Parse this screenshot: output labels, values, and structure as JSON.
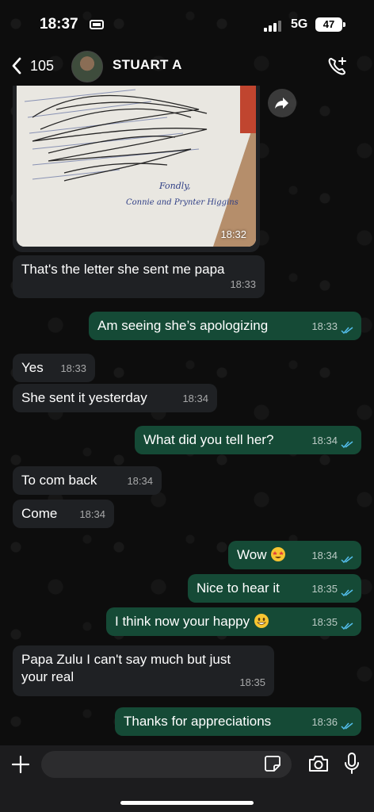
{
  "status_bar": {
    "time": "18:37",
    "network": "5G",
    "battery": "47"
  },
  "header": {
    "back_count": "105",
    "contact_name": "STUART A"
  },
  "messages": [
    {
      "dir": "in",
      "type": "image",
      "time": "18:32"
    },
    {
      "dir": "in",
      "text": "That's the letter she sent me papa",
      "time": "18:33"
    },
    {
      "dir": "out",
      "text": "Am seeing she’s apologizing",
      "time": "18:33",
      "status": "read"
    },
    {
      "dir": "in",
      "text": "Yes",
      "time": "18:33"
    },
    {
      "dir": "in",
      "text": "She sent it yesterday",
      "time": "18:34"
    },
    {
      "dir": "out",
      "text": "What did you tell her?",
      "time": "18:34",
      "status": "read"
    },
    {
      "dir": "in",
      "text": "To com back",
      "time": "18:34"
    },
    {
      "dir": "in",
      "text": "Come",
      "time": "18:34"
    },
    {
      "dir": "out",
      "text": "Wow",
      "emoji": "star-struck-emoji",
      "time": "18:34",
      "status": "read"
    },
    {
      "dir": "out",
      "text": "Nice to hear it",
      "time": "18:35",
      "status": "read"
    },
    {
      "dir": "out",
      "text": "I think now your happy",
      "emoji": "grinning-face-emoji",
      "time": "18:35",
      "status": "read"
    },
    {
      "dir": "in",
      "text_line1": "Papa Zulu I can't say much but just",
      "text_line2": "your real",
      "time": "18:35"
    },
    {
      "dir": "out",
      "text": "Thanks for appreciations",
      "time": "18:36",
      "status": "read"
    }
  ],
  "letter_image": {
    "signature_line1": "Fondly,",
    "signature_line2": "Connie and Prynter Higgins"
  },
  "colors": {
    "incoming_bubble": "#1f2124",
    "outgoing_bubble": "#154a36",
    "read_ticks": "#53bdeb",
    "background": "#0b0b0b"
  },
  "icons": [
    "sim-card-icon",
    "signal-icon",
    "chevron-left-icon",
    "phone-plus-icon",
    "forward-icon",
    "plus-icon",
    "sticker-icon",
    "camera-icon",
    "microphone-icon"
  ]
}
